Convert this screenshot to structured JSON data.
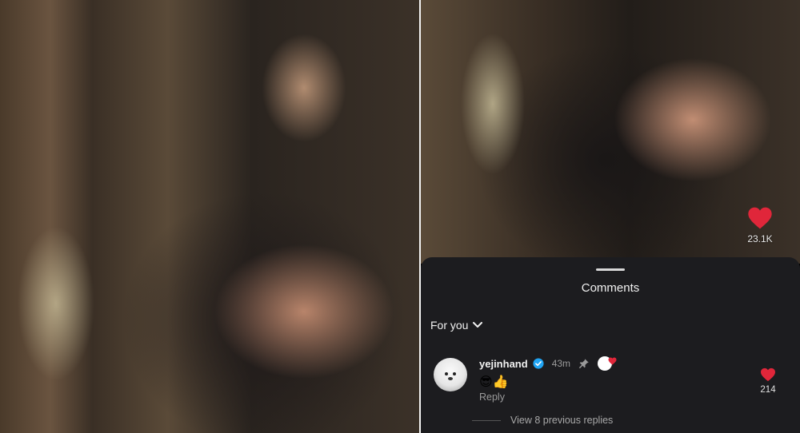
{
  "video": {
    "like_count": "23.1K"
  },
  "comments_sheet": {
    "title": "Comments",
    "filter_label": "For you",
    "comments": [
      {
        "username": "yejinhand",
        "verified": true,
        "timestamp": "43m",
        "pinned": true,
        "text": "😎👍",
        "reply_label": "Reply",
        "like_count": "214",
        "liked": true
      }
    ],
    "view_replies_label": "View 8 previous replies"
  },
  "colors": {
    "like_red": "#e0263a",
    "sheet_bg": "#1c1c1f",
    "verified_blue": "#20a4f3",
    "secondary_text": "#9a9a9a"
  },
  "icons": {
    "video_like": "heart-icon",
    "filter": "chevron-down-icon",
    "verified": "verified-badge-icon",
    "pin": "pin-icon",
    "creator": "creator-heart-badge-icon",
    "comment_like": "heart-icon"
  }
}
